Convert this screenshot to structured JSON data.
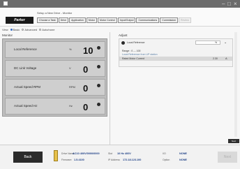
{
  "titlebar": {
    "controls": {
      "minimize": "–",
      "maximize": "□",
      "close": "×"
    }
  },
  "header": {
    "logo": "Parker",
    "breadcrumb": "Setup a New Drive - Monitor",
    "tabs": [
      {
        "label": "Choose a Task",
        "enabled": true
      },
      {
        "label": "Drive",
        "enabled": true
      },
      {
        "label": "Application",
        "enabled": true
      },
      {
        "label": "Motor",
        "enabled": true
      },
      {
        "label": "Motor Control",
        "enabled": true
      },
      {
        "label": "Input/Output",
        "enabled": true
      },
      {
        "label": "Communications",
        "enabled": true
      },
      {
        "label": "Commission",
        "enabled": true
      },
      {
        "label": "Review",
        "enabled": false
      }
    ]
  },
  "view": {
    "label": "View",
    "options": [
      {
        "label": "Basic",
        "selected": true
      },
      {
        "label": "Advanced",
        "selected": false
      },
      {
        "label": "Auto/none",
        "selected": false
      }
    ]
  },
  "monitor": {
    "title": "Monitor",
    "rows": [
      {
        "label": "Local Reference",
        "unit": "%",
        "value": "10"
      },
      {
        "label": "DC Link Voltage",
        "unit": "V",
        "value": "0"
      },
      {
        "label": "Actual Speed RPM",
        "unit": "RPM",
        "value": "0"
      },
      {
        "label": "Actual Speed Hz",
        "unit": "Hz",
        "value": "0"
      }
    ]
  },
  "adjust": {
    "title": "Adjust",
    "param_label": "Local Reference",
    "unit": "%",
    "range_text": "Range : 0 --- 100",
    "hint_text": "Local Reference from UP station",
    "row_label": "Rated Motor Current",
    "row_value": "2.30",
    "row_unit": "A"
  },
  "side_button": "Next",
  "footer": {
    "back_label": "Back",
    "next_label": "Next",
    "drive_name_label": "Drive Name",
    "drive_name_value": "AC10 400V/0000/0000",
    "slot_label": "Slot",
    "slot_value": "10 Hz 400V",
    "io_label": "I/O",
    "io_value": "NONE",
    "firmware_label": "Firmware",
    "firmware_value": "1.5.4100",
    "ip_label": "IP Address",
    "ip_value": "172.18.123.100",
    "option_label": "Option",
    "option_value": "NONE"
  }
}
